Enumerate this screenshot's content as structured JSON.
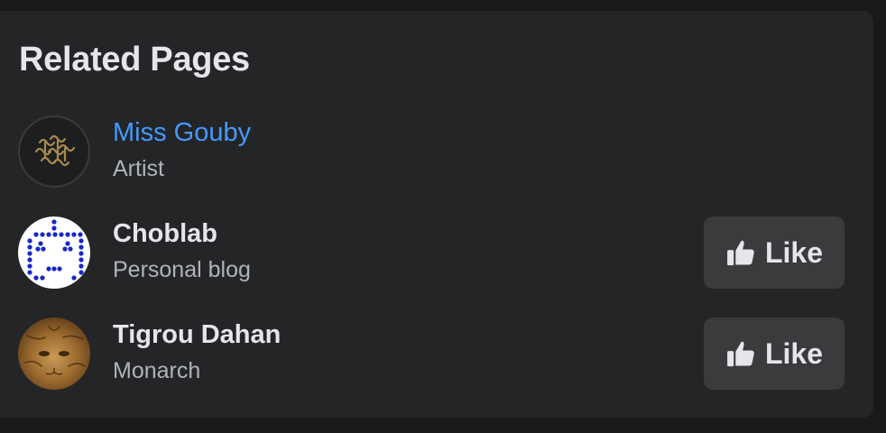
{
  "section": {
    "title": "Related Pages"
  },
  "pages": [
    {
      "name": "Miss Gouby",
      "category": "Artist",
      "avatar_icon": "gold-ornament-logo",
      "has_like_button": false
    },
    {
      "name": "Choblab",
      "category": "Personal blog",
      "avatar_icon": "blue-dotted-robot-face",
      "has_like_button": true,
      "like_label": "Like"
    },
    {
      "name": "Tigrou Dahan",
      "category": "Monarch",
      "avatar_icon": "cat-photo",
      "has_like_button": true,
      "like_label": "Like"
    }
  ],
  "colors": {
    "page_background": "#18191a",
    "card_background": "#242526",
    "button_background": "#3a3b3c",
    "primary_text": "#e4e6eb",
    "secondary_text": "#b0b3b8",
    "link_text": "#4599ff"
  }
}
